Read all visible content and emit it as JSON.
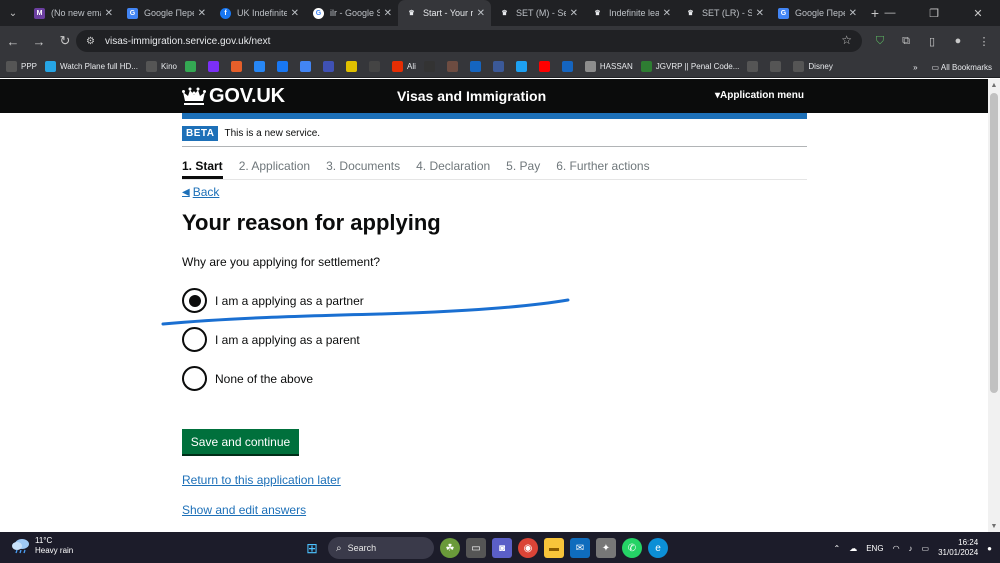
{
  "browser": {
    "tabs": [
      {
        "title": "(No new ema",
        "favicon_color": "#6b3fa0",
        "favicon": "M"
      },
      {
        "title": "Google Пере",
        "favicon_color": "#4285f4",
        "favicon": "G"
      },
      {
        "title": "UK Indefinite",
        "favicon_color": "#1877f2",
        "favicon": "f"
      },
      {
        "title": "ilr - Google S",
        "favicon_color": "#ffffff",
        "favicon": "G"
      },
      {
        "title": "Start - Your r",
        "favicon_color": "#0b0c0c",
        "favicon": "♛",
        "active": true
      },
      {
        "title": "SET (M) - Set",
        "favicon_color": "#0b0c0c",
        "favicon": "♛"
      },
      {
        "title": "Indefinite lea",
        "favicon_color": "#0b0c0c",
        "favicon": "♛"
      },
      {
        "title": "SET (LR) - Set",
        "favicon_color": "#0b0c0c",
        "favicon": "♛"
      },
      {
        "title": "Google Пере",
        "favicon_color": "#4285f4",
        "favicon": "G"
      }
    ],
    "url": "visas-immigration.service.gov.uk/next",
    "bookmarks": [
      {
        "label": "PPP",
        "color": "#555"
      },
      {
        "label": "Watch Plane full HD...",
        "color": "#26a5e4"
      },
      {
        "label": "Kino",
        "color": "#555"
      },
      {
        "label": "",
        "color": "#34a853"
      },
      {
        "label": "",
        "color": "#7b2ff7"
      },
      {
        "label": "",
        "color": "#e55f2a"
      },
      {
        "label": "",
        "color": "#2787f5"
      },
      {
        "label": "",
        "color": "#1877f2"
      },
      {
        "label": "",
        "color": "#4285f4"
      },
      {
        "label": "",
        "color": "#3f51b5"
      },
      {
        "label": "",
        "color": "#e0c000"
      },
      {
        "label": "",
        "color": "#444"
      },
      {
        "label": "Ali",
        "color": "#e62e04"
      },
      {
        "label": "",
        "color": "#333"
      },
      {
        "label": "",
        "color": "#6d4c41"
      },
      {
        "label": "",
        "color": "#1565c0"
      },
      {
        "label": "",
        "color": "#3b5998"
      },
      {
        "label": "",
        "color": "#1da1f2"
      },
      {
        "label": "",
        "color": "#ff0000"
      },
      {
        "label": "",
        "color": "#1565c0"
      },
      {
        "label": "HASSAN",
        "color": "#8d8d8d"
      },
      {
        "label": "JGVRP || Penal Code...",
        "color": "#2e7d32"
      },
      {
        "label": "",
        "color": "#555"
      },
      {
        "label": "",
        "color": "#555"
      },
      {
        "label": "Disney",
        "color": "#555"
      }
    ],
    "all_bookmarks": "All Bookmarks"
  },
  "header": {
    "logo": "GOV.UK",
    "service": "Visas and Immigration",
    "menu": "Application menu"
  },
  "phase": {
    "tag": "BETA",
    "text": "This is a new service."
  },
  "steps": [
    "1. Start",
    "2. Application",
    "3. Documents",
    "4. Declaration",
    "5. Pay",
    "6. Further actions"
  ],
  "back": "Back",
  "title": "Your reason for applying",
  "question": "Why are you applying for settlement?",
  "options": [
    {
      "label": "I am a applying as a partner",
      "checked": true
    },
    {
      "label": "I am a applying as a parent",
      "checked": false
    },
    {
      "label": "None of the above",
      "checked": false
    }
  ],
  "save_button": "Save and continue",
  "links": {
    "return_later": "Return to this application later",
    "show_edit": "Show and edit answers"
  },
  "taskbar": {
    "temperature": "11°C",
    "weather": "Heavy rain",
    "search": "Search",
    "language": "ENG",
    "time": "16:24",
    "date": "31/01/2024"
  },
  "colors": {
    "govuk_blue": "#1d70b8",
    "govuk_green": "#00703c",
    "annotation": "#1a6fd1"
  }
}
